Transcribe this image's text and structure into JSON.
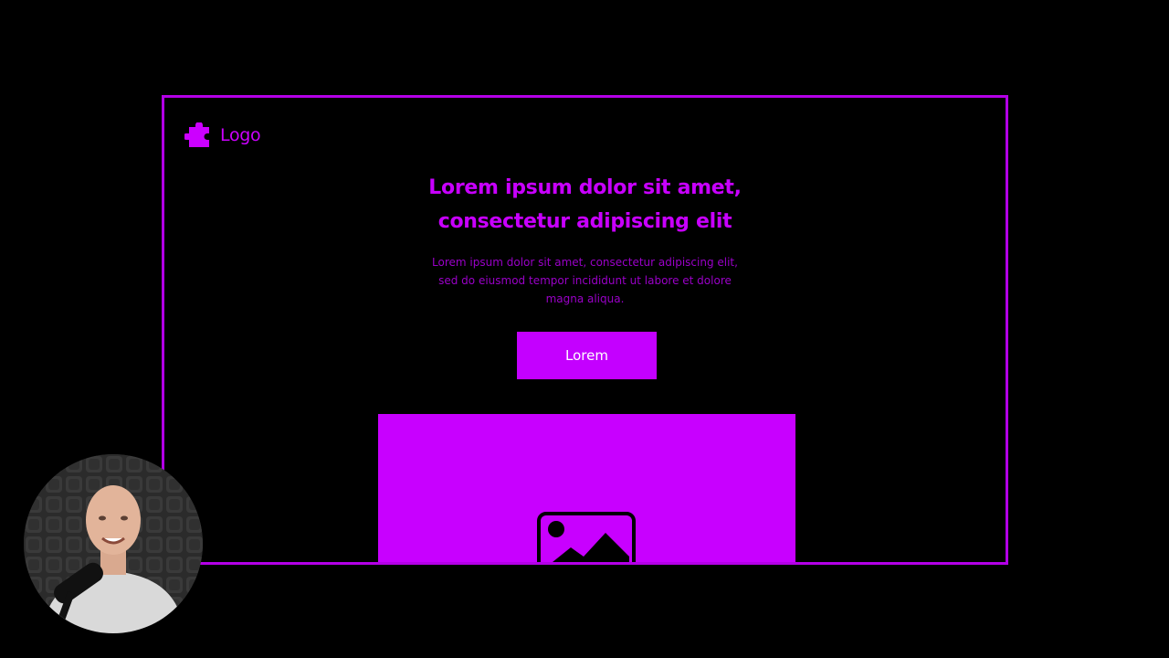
{
  "logo": {
    "text": "Logo",
    "icon": "puzzle-piece-icon"
  },
  "hero": {
    "headline_line1": "Lorem ipsum dolor sit amet,",
    "headline_line2": "consectetur adipiscing elit",
    "body_line1": "Lorem ipsum dolor sit amet, consectetur adipiscing elit,",
    "body_line2": "sed do eiusmod tempor incididunt ut labore et dolore",
    "body_line3": "magna aliqua.",
    "button_label": "Lorem",
    "image_icon": "image-placeholder-icon"
  },
  "colors": {
    "accent": "#c800ff",
    "frame_border": "#b300e6",
    "background": "#000000",
    "button_text": "#ffffff"
  },
  "webcam": {
    "icon": "presenter-webcam"
  }
}
